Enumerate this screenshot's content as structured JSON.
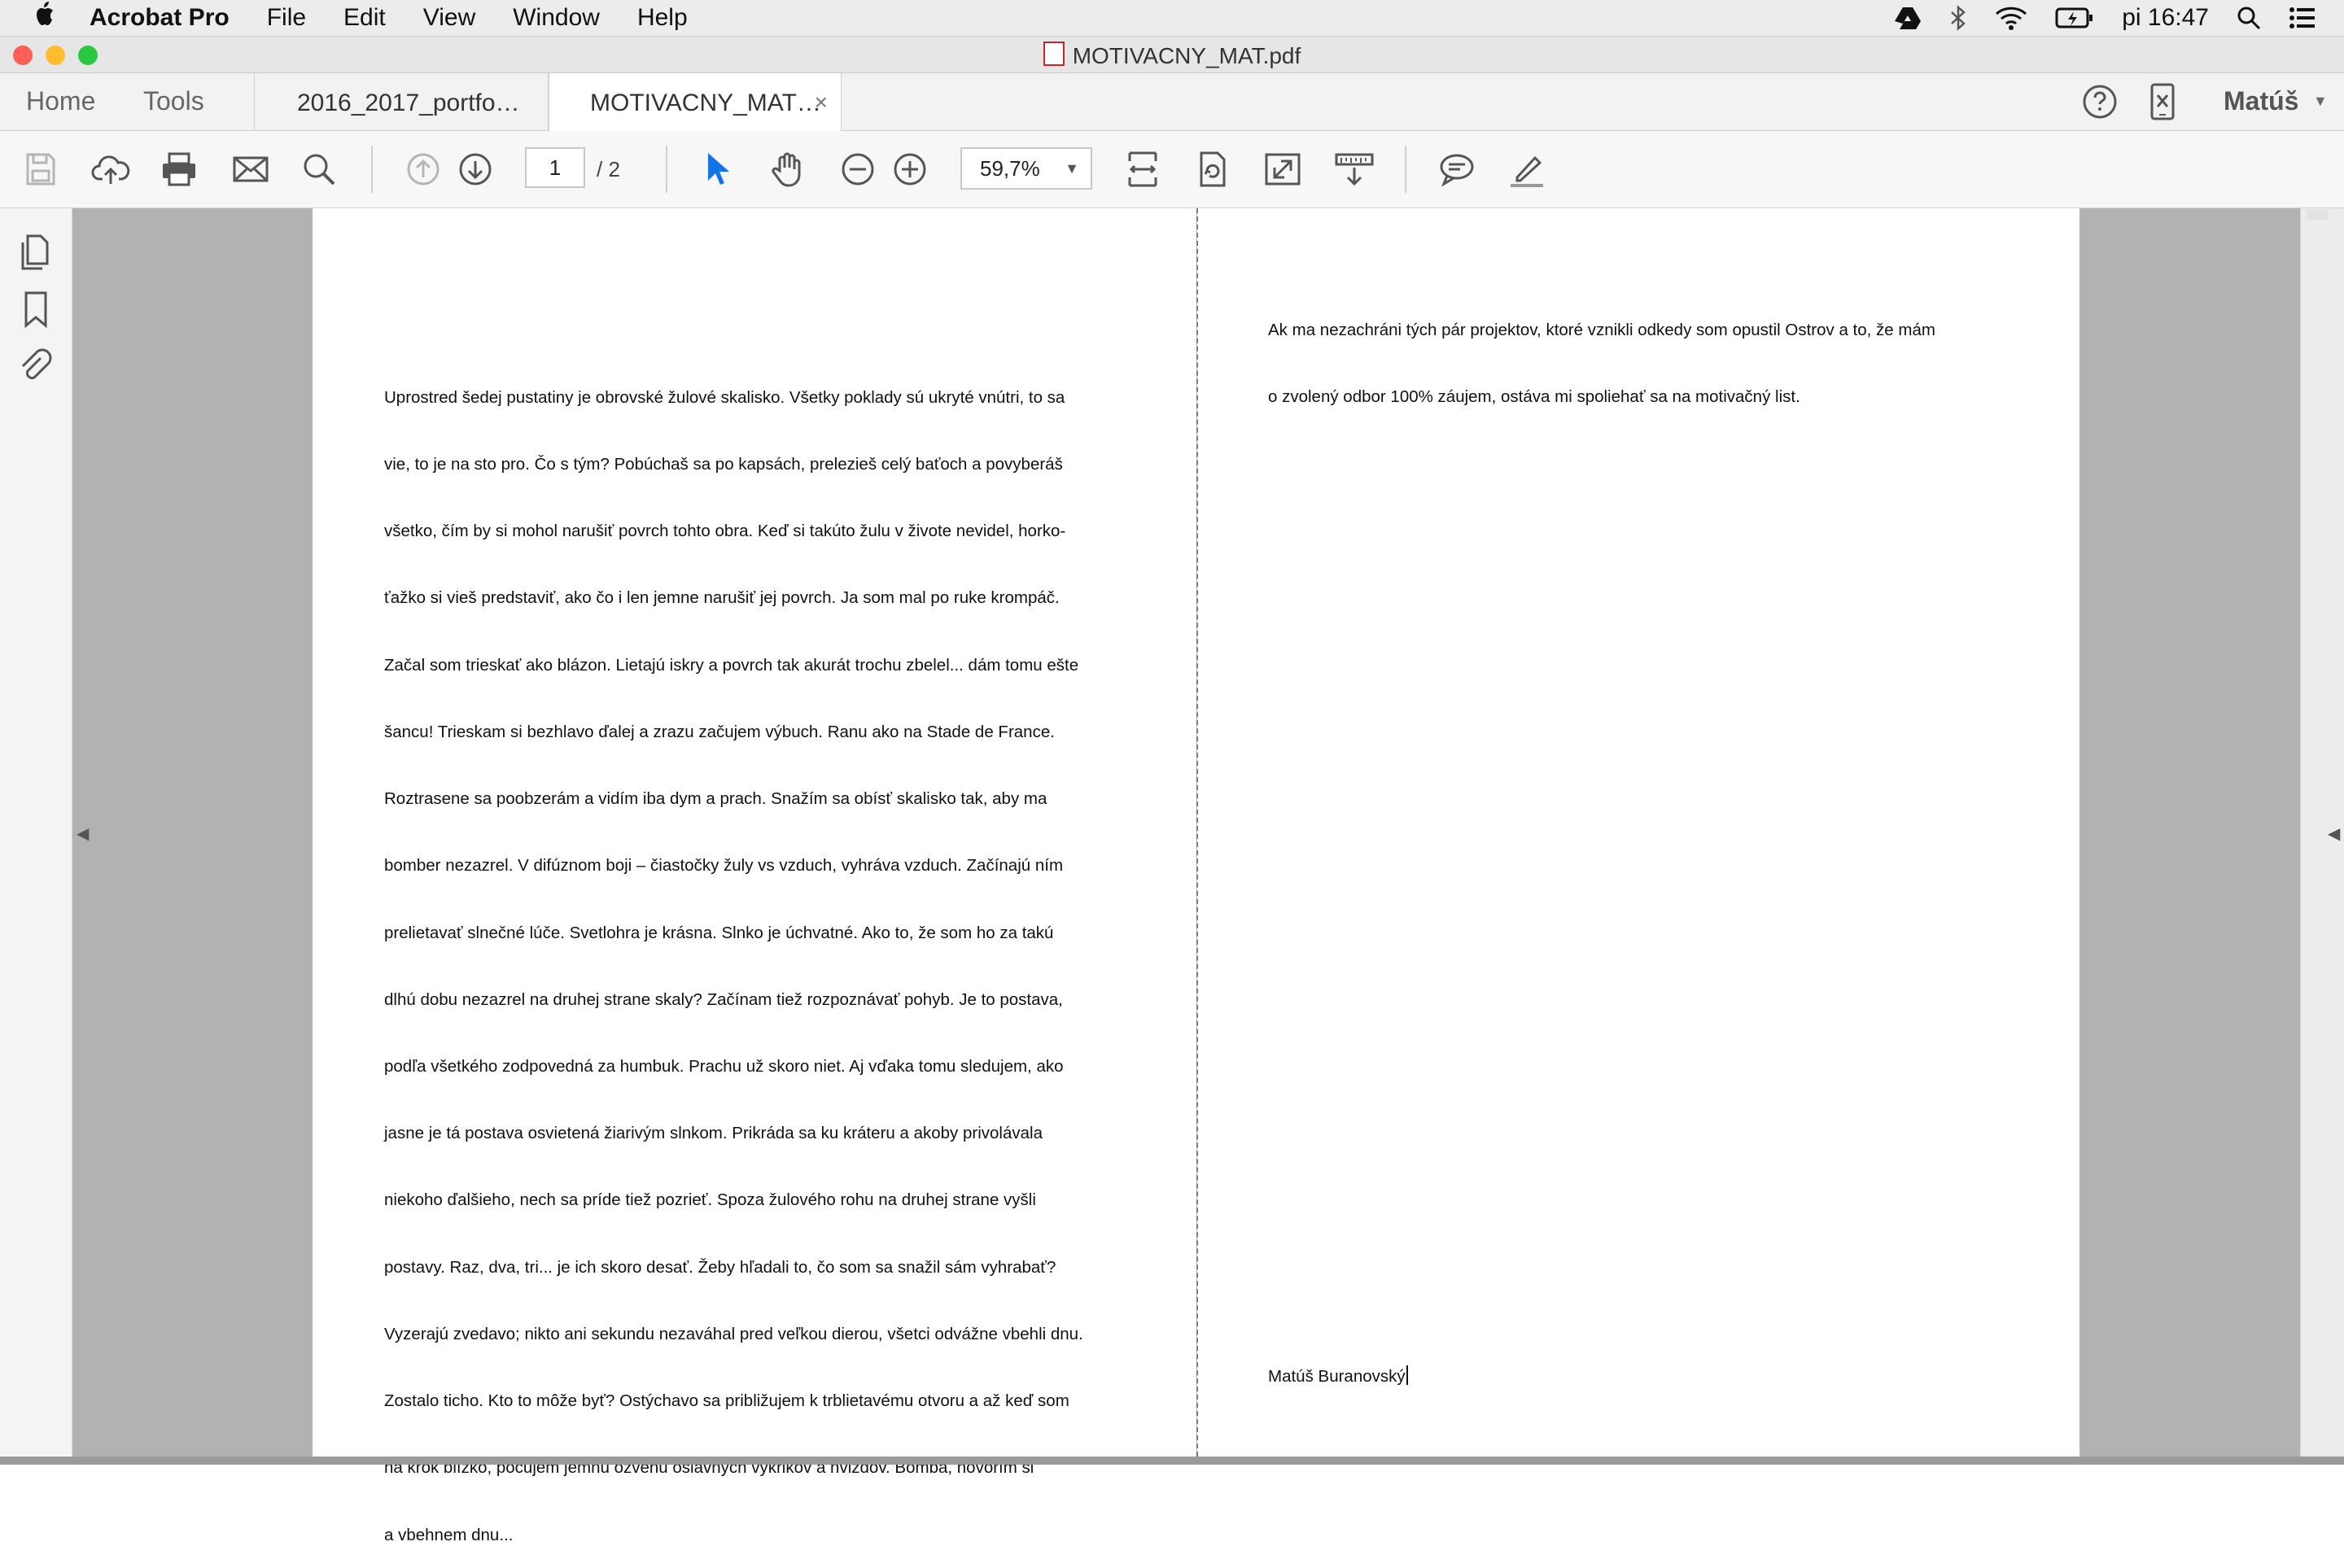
{
  "menubar": {
    "app_name": "Acrobat Pro",
    "items": [
      "File",
      "Edit",
      "View",
      "Window",
      "Help"
    ],
    "clock": "pi 16:47",
    "status_icons": [
      "google-drive-icon",
      "bluetooth-icon",
      "wifi-icon",
      "battery-icon",
      "spotlight-icon",
      "notification-center-icon"
    ]
  },
  "window": {
    "title": "MOTIVACNY_MAT.pdf"
  },
  "tabs": {
    "home": "Home",
    "tools": "Tools",
    "documents": [
      "2016_2017_portfo…",
      "MOTIVACNY_MAT…"
    ],
    "close": "×",
    "user": "Matúš"
  },
  "toolbar": {
    "page_current": "1",
    "page_total": "/ 2",
    "zoom": "59,7%"
  },
  "document": {
    "page1_text": [
      "Uprostred šedej pustatiny je obrovské žulové skalisko. Všetky poklady sú ukryté vnútri, to sa",
      "vie, to je na sto pro. Čo s tým? Pobúchaš sa po kapsách, prelezieš celý baťoch a povyberáš",
      "všetko, čím by si mohol narušiť povrch tohto obra. Keď si takúto žulu v živote nevidel, horko-",
      "ťažko si vieš predstaviť, ako čo i len jemne narušiť jej povrch. Ja som mal po ruke krompáč.",
      "Začal som trieskať ako blázon. Lietajú iskry a povrch tak akurát trochu zbelel... dám tomu ešte",
      "šancu! Trieskam si bezhlavo ďalej a zrazu začujem výbuch. Ranu ako na Stade de France.",
      "Roztrasene sa poobzerám a vidím iba dym a prach. Snažím sa obísť skalisko tak, aby ma",
      "bomber nezazrel. V difúznom boji – čiastočky žuly vs vzduch, vyhráva vzduch. Začínajú ním",
      "prelietavať slnečné lúče. Svetlohra je krásna. Slnko je úchvatné. Ako to, že som ho za takú",
      "dlhú dobu nezazrel na druhej strane skaly? Začínam tiež rozpoznávať pohyb. Je to postava,",
      "podľa všetkého zodpovedná za humbuk. Prachu už skoro niet. Aj vďaka tomu sledujem, ako",
      "jasne je tá postava osvietená žiarivým slnkom. Prikráda sa ku kráteru a akoby privolávala",
      "niekoho ďalšieho, nech sa príde tiež pozrieť. Spoza žulového rohu na druhej strane vyšli",
      "postavy. Raz, dva, tri... je ich skoro desať. Žeby hľadali to, čo som sa snažil sám vyhrabať?",
      "Vyzerajú zvedavo; nikto ani sekundu nezaváhal pred veľkou dierou, všetci odvážne vbehli dnu.",
      "Zostalo ticho. Kto to môže byť? Ostýchavo sa približujem k trblietavému otvoru a až keď som",
      "na krok blízko, počujem jemnú ozvenu oslavných výkrikov a hvizdov. Bomba, hovorím si",
      "a vbehnem dnu..."
    ],
    "page2_text": [
      "Ak ma nezachráni tých pár projektov, ktoré vznikli odkedy som opustil Ostrov a to, že mám",
      "o zvolený odbor 100% záujem, ostáva mi spoliehať sa na motivačný list."
    ],
    "signature": "Matúš Buranovský"
  },
  "colors": {
    "accent_blue": "#1473e6",
    "close_red": "#fe5f57",
    "minimize_yellow": "#febc2e",
    "zoom_green": "#28c840",
    "workspace_gray": "#b2b2b2"
  }
}
